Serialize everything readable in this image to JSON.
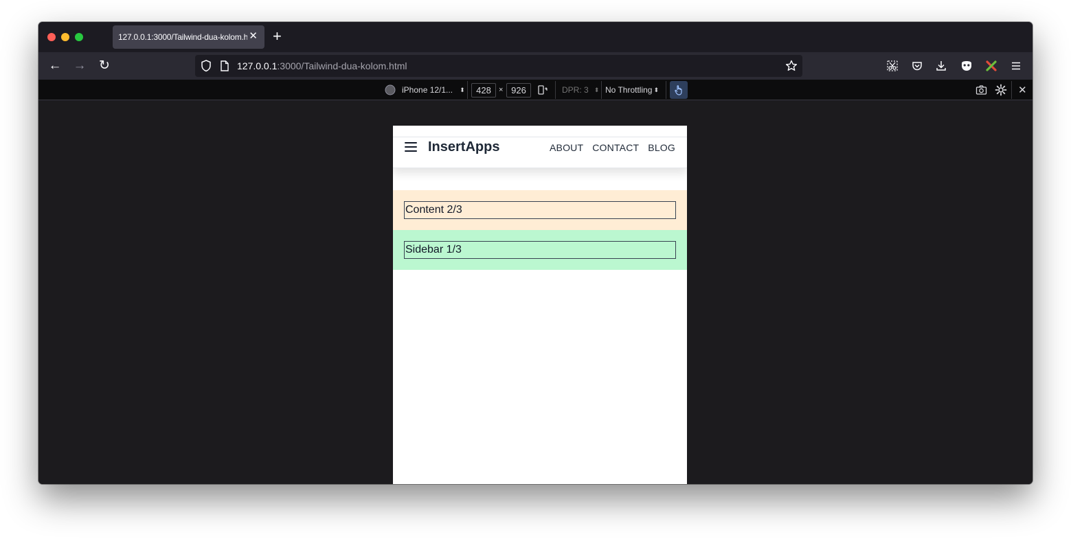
{
  "browser": {
    "tab_title": "127.0.0.1:3000/Tailwind-dua-kolom.html",
    "tab_close": "✕",
    "new_tab": "+",
    "url_host": "127.0.0.1",
    "url_rest": ":3000/Tailwind-dua-kolom.html",
    "back": "←",
    "forward": "→",
    "reload": "↻"
  },
  "rdm": {
    "device": "iPhone 12/1...",
    "width": "428",
    "times": "×",
    "height": "926",
    "dpr": "DPR: 3",
    "throttling": "No Throttling",
    "close": "✕"
  },
  "page": {
    "brand": "InsertApps",
    "nav": [
      "ABOUT",
      "CONTACT",
      "BLOG"
    ],
    "content_label": "Content 2/3",
    "sidebar_label": "Sidebar 1/3"
  },
  "colors": {
    "content_bg": "#ffedd5",
    "sidebar_bg": "#bbf7d0"
  }
}
